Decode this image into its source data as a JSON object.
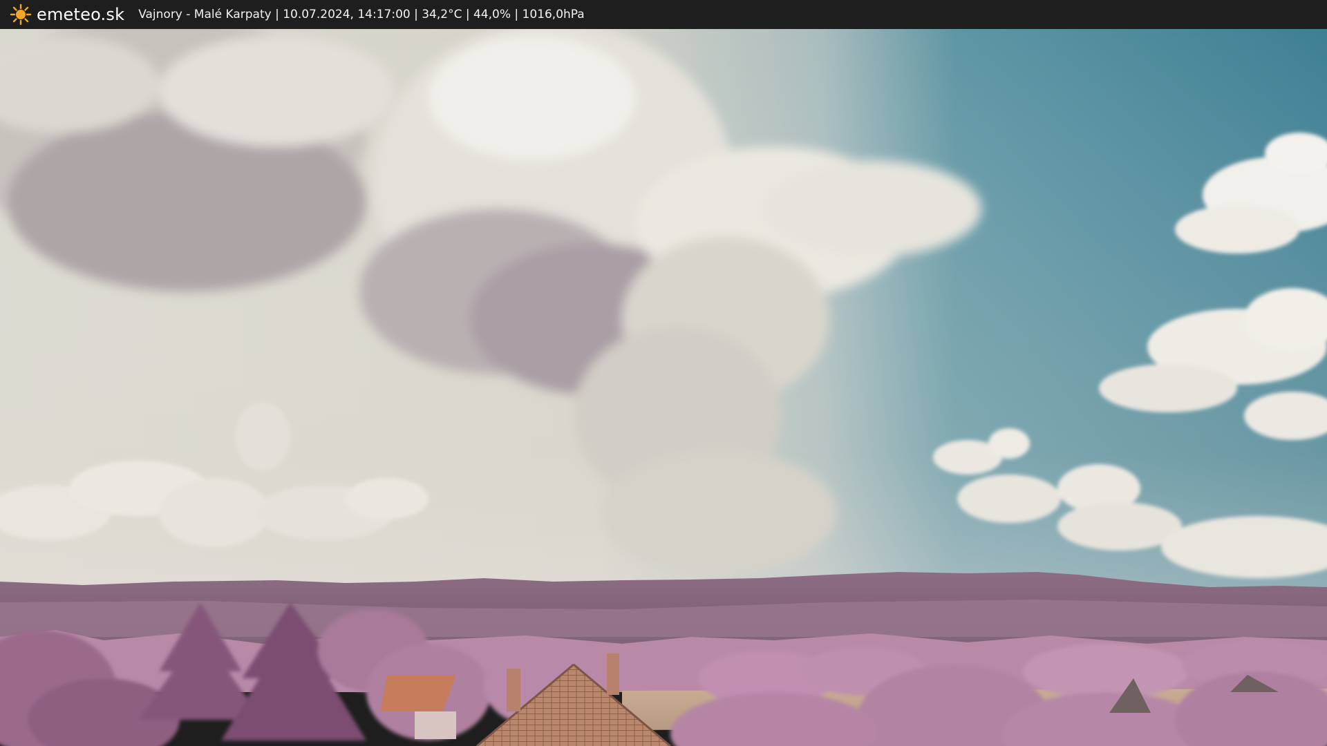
{
  "header": {
    "logo_text": "emeteo.sk",
    "logo_icon": "sun-icon",
    "caption": "Vajnory - Malé Karpaty | 10.07.2024, 14:17:00 | 34,2°C | 44,0% | 1016,0hPa"
  },
  "colors": {
    "topbar": "#1e1e1e",
    "sun": "#f5a623",
    "sky_blue": "#4a8a9c",
    "sky_haze": "#d7d6cc",
    "foliage": "#b07fa0",
    "hills": "#8b6b80",
    "roof": "#c27a55",
    "field": "#c7a98c"
  }
}
